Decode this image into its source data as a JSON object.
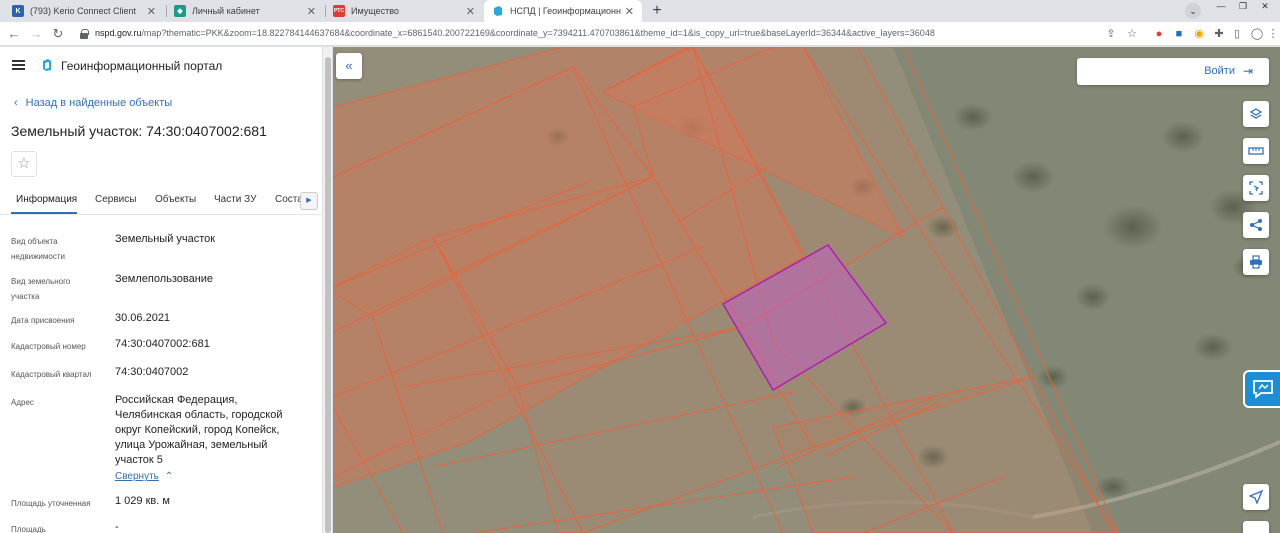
{
  "browser": {
    "tabs": [
      {
        "title": "(793) Kerio Connect Client",
        "active": false
      },
      {
        "title": "Личный кабинет",
        "active": false
      },
      {
        "title": "Имущество",
        "active": false
      },
      {
        "title": "НСПД | Геоинформационный п",
        "active": true
      }
    ],
    "new_tab": "+",
    "url_host": "nspd.gov.ru",
    "url_rest": "/map?thematic=PKK&zoom=18.822784144637684&coordinate_x=6861540.200722169&coordinate_y=7394211.470703861&theme_id=1&is_copy_url=true&baseLayerId=36344&active_layers=36048"
  },
  "header": {
    "portal_title": "Геоинформационный портал"
  },
  "panel": {
    "back_link": "Назад в найденные объекты",
    "object_title": "Земельный участок: 74:30:0407002:681",
    "tabs": [
      "Информация",
      "Сервисы",
      "Объекты",
      "Части ЗУ",
      "Соста"
    ],
    "rows": [
      {
        "label": "Вид объекта недвижимости",
        "value": "Земельный участок"
      },
      {
        "label": "Вид земельного участка",
        "value": "Землепользование"
      },
      {
        "label": "Дата присвоения",
        "value": "30.06.2021"
      },
      {
        "label": "Кадастровый номер",
        "value": "74:30:0407002:681"
      },
      {
        "label": "Кадастровый квартал",
        "value": "74:30:0407002"
      },
      {
        "label": "Адрес",
        "value": "Российская Федерация, Челябинская область, городской округ Копейский, город Копейск, улица Урожайная, земельный участок 5"
      },
      {
        "label": "Площадь уточненная",
        "value": "1 029 кв. м"
      },
      {
        "label": "Площадь",
        "value": "-"
      }
    ],
    "collapse_link": "Свернуть"
  },
  "map": {
    "login_label": "Войти",
    "tools": [
      "layers-icon",
      "ruler-icon",
      "select-area-icon",
      "share-icon",
      "print-icon",
      "locate-icon"
    ],
    "colors": {
      "parcel_stroke": "#e8633c",
      "parcel_fill": "#d07a5a",
      "selected_stroke": "#b020b0",
      "selected_fill": "#c060c0",
      "accent": "#2f6fb6"
    }
  }
}
